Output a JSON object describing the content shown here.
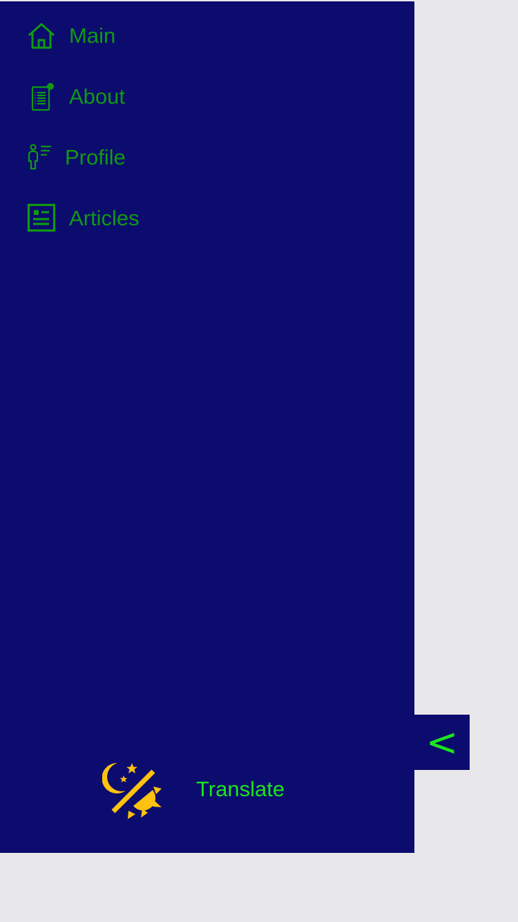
{
  "sidebar": {
    "items": [
      {
        "label": "Main",
        "icon": "home-icon"
      },
      {
        "label": "About",
        "icon": "document-icon"
      },
      {
        "label": "Profile",
        "icon": "person-list-icon"
      },
      {
        "label": "Articles",
        "icon": "newspaper-icon"
      }
    ],
    "theme_toggle_icon": "day-night-icon",
    "translate_label": "Translate",
    "collapse_label": "<"
  },
  "colors": {
    "sidebar_bg": "#0c0b6e",
    "page_bg": "#e8e8ea",
    "nav_text": "#0f9a12",
    "translate_text": "#19e61b",
    "theme_icon": "#ffc20e"
  }
}
